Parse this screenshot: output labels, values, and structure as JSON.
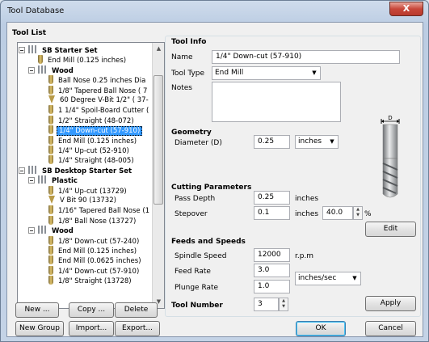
{
  "window": {
    "title": "Tool Database",
    "close_label": "X"
  },
  "tool_list": {
    "label": "Tool List",
    "tree": [
      {
        "text": "SB Starter Set",
        "kind": "group",
        "level": 0
      },
      {
        "text": "End Mill (0.125 inches)",
        "kind": "tool",
        "level": 1
      },
      {
        "text": "Wood",
        "kind": "group",
        "level": 1
      },
      {
        "text": "Ball Nose 0.25 inches Dia",
        "kind": "ball",
        "level": 2
      },
      {
        "text": "1/8\" Tapered Ball Nose ( 7",
        "kind": "ball",
        "level": 2
      },
      {
        "text": "60 Degree V-Bit 1/2\"  ( 37-",
        "kind": "vbit",
        "level": 2
      },
      {
        "text": "1 1/4\" Spoil-Board Cutter (",
        "kind": "tool",
        "level": 2
      },
      {
        "text": "1/2\" Straight  (48-072)",
        "kind": "tool",
        "level": 2
      },
      {
        "text": "1/4\"  Down-cut (57-910)",
        "kind": "tool",
        "level": 2,
        "selected": true
      },
      {
        "text": "End Mill (0.125 inches)",
        "kind": "tool",
        "level": 2
      },
      {
        "text": "1/4\" Up-cut (52-910)",
        "kind": "tool",
        "level": 2
      },
      {
        "text": "1/4\" Straight  (48-005)",
        "kind": "tool",
        "level": 2
      },
      {
        "text": "SB Desktop Starter Set",
        "kind": "group",
        "level": 0
      },
      {
        "text": "Plastic",
        "kind": "group",
        "level": 1
      },
      {
        "text": "1/4\" Up-cut (13729)",
        "kind": "tool",
        "level": 2
      },
      {
        "text": "V Bit 90 (13732)",
        "kind": "vbit",
        "level": 2
      },
      {
        "text": "1/16\" Tapered Ball Nose (1",
        "kind": "ball",
        "level": 2
      },
      {
        "text": "1/8\" Ball Nose (13727)",
        "kind": "ball",
        "level": 2
      },
      {
        "text": "Wood",
        "kind": "group",
        "level": 1
      },
      {
        "text": "1/8\" Down-cut (57-240)",
        "kind": "tool",
        "level": 2
      },
      {
        "text": "End Mill (0.125 inches)",
        "kind": "tool",
        "level": 2
      },
      {
        "text": "End Mill (0.0625 inches)",
        "kind": "tool",
        "level": 2
      },
      {
        "text": "1/4\"  Down-cut (57-910)",
        "kind": "tool",
        "level": 2
      },
      {
        "text": "1/8\" Straight  (13728)",
        "kind": "tool",
        "level": 2
      }
    ],
    "buttons": {
      "new": "New ...",
      "copy": "Copy ...",
      "delete": "Delete",
      "new_group": "New Group",
      "import": "Import...",
      "export": "Export..."
    }
  },
  "tool_info": {
    "label": "Tool Info",
    "name_label": "Name",
    "name_value": "1/4\"  Down-cut (57-910)",
    "type_label": "Tool Type",
    "type_value": "End Mill",
    "notes_label": "Notes",
    "notes_value": ""
  },
  "geometry": {
    "label": "Geometry",
    "diameter_label": "Diameter (D)",
    "diameter_value": "0.25",
    "units_value": "inches",
    "diagram_label": "D"
  },
  "cutting": {
    "label": "Cutting Parameters",
    "pass_depth_label": "Pass Depth",
    "pass_depth_value": "0.25",
    "pass_depth_unit": "inches",
    "stepover_label": "Stepover",
    "stepover_value": "0.1",
    "stepover_unit": "inches",
    "stepover_percent": "40.0",
    "percent_sign": "%",
    "edit_label": "Edit"
  },
  "feeds": {
    "label": "Feeds and Speeds",
    "spindle_label": "Spindle Speed",
    "spindle_value": "12000",
    "spindle_unit": "r.p.m",
    "feed_label": "Feed Rate",
    "feed_value": "3.0",
    "plunge_label": "Plunge Rate",
    "plunge_value": "1.0",
    "rate_units": "inches/sec"
  },
  "tool_number": {
    "label": "Tool Number",
    "value": "3",
    "apply_label": "Apply"
  },
  "footer": {
    "ok": "OK",
    "cancel": "Cancel"
  }
}
